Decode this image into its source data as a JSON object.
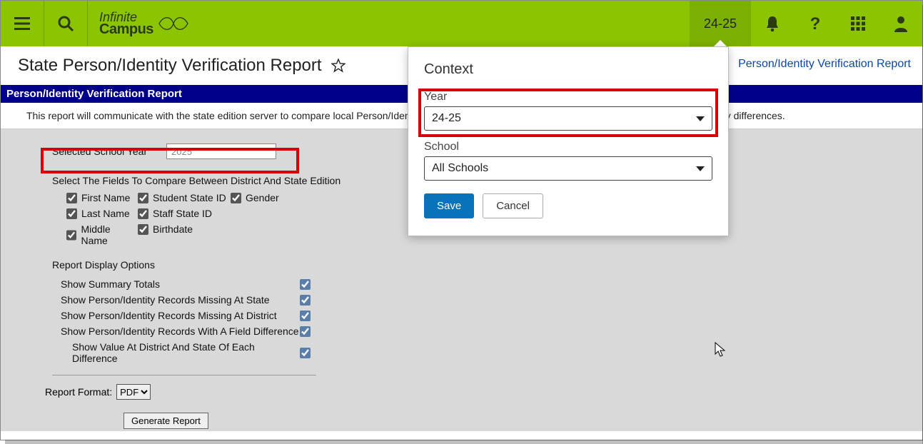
{
  "topbar": {
    "year_label": "24-25",
    "logo_line1": "Infinite",
    "logo_line2": "Campus"
  },
  "title": "State Person/Identity Verification Report",
  "breadcrumb_right": "Person/Identity Verification Report",
  "bluebar": "Person/Identity Verification Report",
  "description": "This report will communicate with the state edition server to compare local Person/Identity data with the state, it will then generate a report that summarizes any differences.",
  "form": {
    "selected_year_label": "Selected School Year",
    "selected_year_value": "2025",
    "compare_label": "Select The Fields To Compare Between District And State Edition",
    "checks": {
      "c1": [
        "First Name",
        "Last Name",
        "Middle Name"
      ],
      "c2": [
        "Student State ID",
        "Staff State ID",
        "Birthdate"
      ],
      "c3": [
        "Gender"
      ]
    },
    "display_label": "Report Display Options",
    "display_opts": [
      "Show Summary Totals",
      "Show Person/Identity Records Missing At State",
      "Show Person/Identity Records Missing At District",
      "Show Person/Identity Records With A Field Difference",
      "Show Value At District And State Of Each Difference"
    ],
    "format_label": "Report Format:",
    "format_value": "PDF",
    "generate_label": "Generate Report"
  },
  "popover": {
    "title": "Context",
    "year_label": "Year",
    "year_value": "24-25",
    "school_label": "School",
    "school_value": "All Schools",
    "save": "Save",
    "cancel": "Cancel"
  }
}
